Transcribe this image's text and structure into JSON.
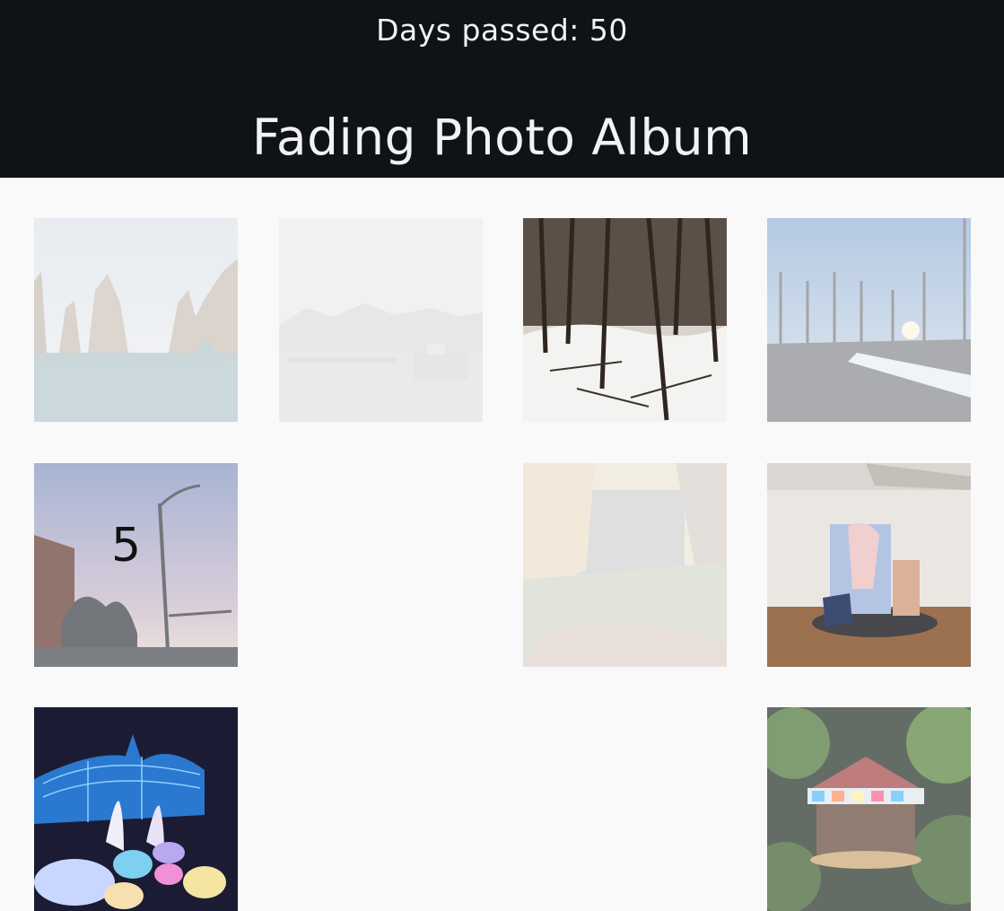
{
  "header": {
    "days_passed": "Days passed: 50",
    "title": "Fading Photo Album"
  },
  "album": {
    "photos": [
      {
        "name": "sea-arches-photo",
        "fade": 0.72
      },
      {
        "name": "harbor-mountains-photo",
        "fade": 0.88
      },
      {
        "name": "snowy-forest-photo",
        "fade": 0.0
      },
      {
        "name": "winter-park-sunset-photo",
        "fade": 0.55
      },
      {
        "name": "city-streetlight-photo",
        "fade": 0.35,
        "overlay_number": "5"
      },
      {
        "name": "autumn-courtyard-photo",
        "fade": 0.85
      },
      {
        "name": "gallery-sculpture-photo",
        "fade": 0.15
      },
      {
        "name": "conservatory-lights-photo",
        "fade": 0.0
      },
      {
        "name": "carousel-night-photo",
        "fade": 0.35
      }
    ]
  },
  "colors": {
    "header_bg": "#0f1217",
    "page_bg": "#f9f9f9",
    "header_text": "#f2f2f2"
  }
}
